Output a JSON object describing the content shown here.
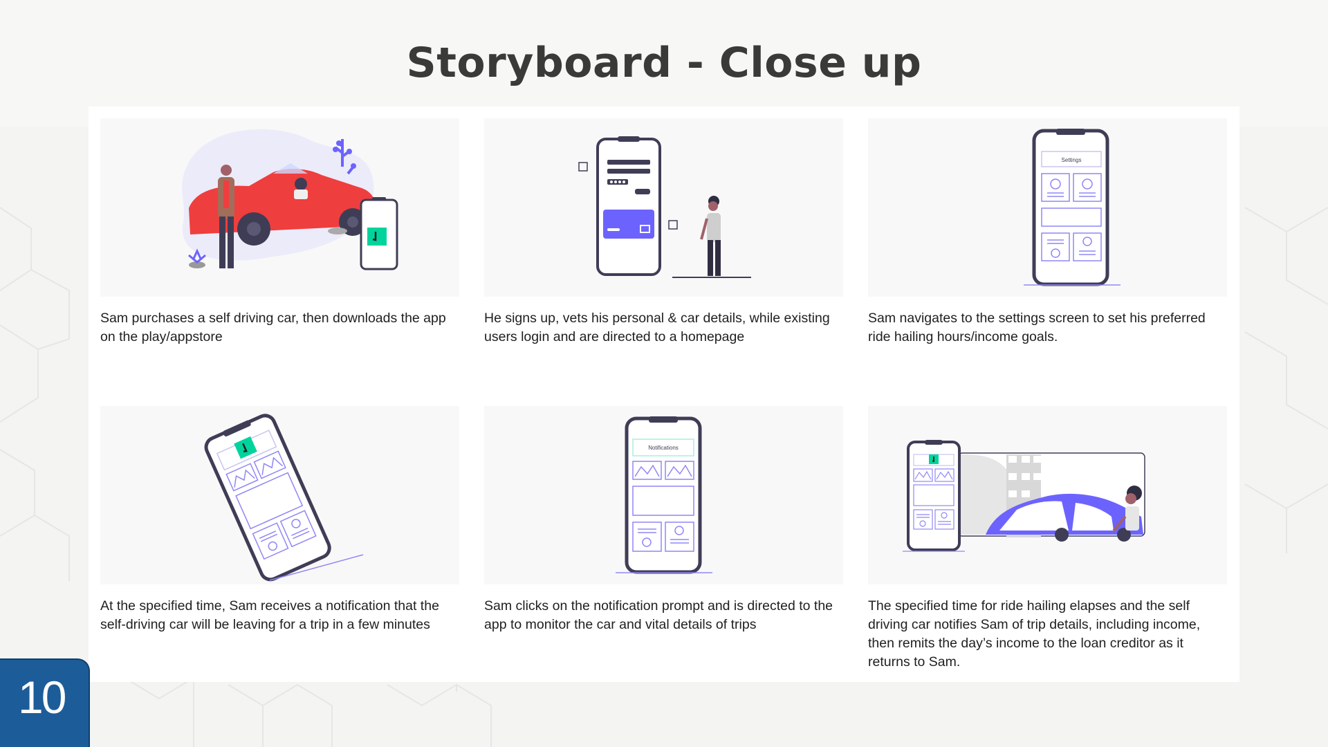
{
  "slide": {
    "title": "Storyboard - Close up",
    "page_number": "10"
  },
  "colors": {
    "accent_purple": "#6c63ff",
    "phone_outline": "#3f3d56",
    "brand_green": "#00d49c",
    "car_red": "#ef3e3e",
    "badge_blue": "#1c5d99"
  },
  "storyboard": {
    "frames": [
      {
        "caption": "Sam purchases a self driving car, then  downloads the app on the play/appstore"
      },
      {
        "caption": "He signs up, vets his personal & car details, while existing users login and are directed to a homepage"
      },
      {
        "caption": "Sam navigates to the settings screen to set his preferred ride hailing hours/income goals.",
        "screen_label": "Settings"
      },
      {
        "caption": "At the specified time, Sam receives a notification that the self-driving car will be leaving for a trip in a few minutes"
      },
      {
        "caption": "Sam clicks on the notification prompt and is directed to the app to monitor the car and vital details of trips",
        "screen_label": "Notifications"
      },
      {
        "caption": "The specified time for ride hailing elapses and the self driving car notifies Sam of trip details, including income, then remits the day’s income to the loan creditor as it returns to Sam."
      }
    ]
  }
}
